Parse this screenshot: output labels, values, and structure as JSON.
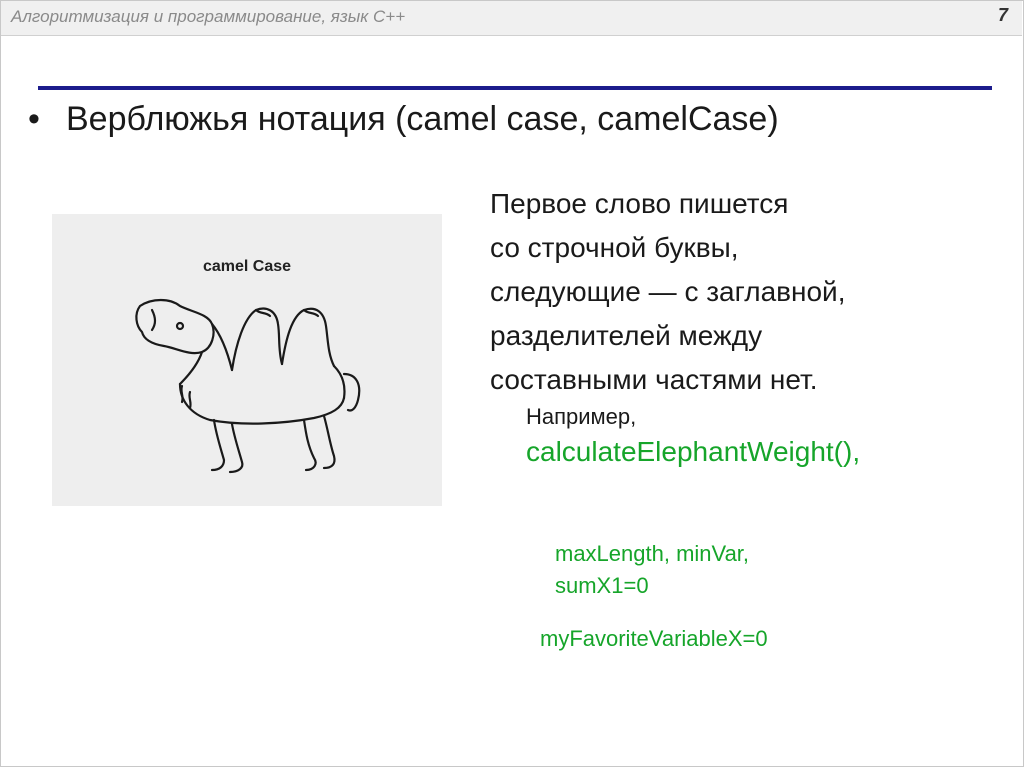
{
  "header": {
    "course_title": "Алгоритмизация и программирование, язык С++",
    "slide_number": "7"
  },
  "slide": {
    "bullet": "•",
    "heading": "Верблюжья нотация (camel case, camelCase)",
    "image_caption": "camel Case",
    "description_lines": [
      "Первое слово пишется",
      "со строчной буквы,",
      "следующие — с заглавной,",
      "разделителей между",
      "составными частями нет."
    ],
    "example_label": "Например,",
    "example_main": "calculateElephantWeight(),",
    "example_2_lines": [
      "maxLength, minVar,",
      "sumX1=0"
    ],
    "example_3": "myFavoriteVariableX=0"
  },
  "colors": {
    "rule": "#1c1c8c",
    "example_text": "#16a52a",
    "header_bg": "#f0f0f0",
    "image_bg": "#eeeeee"
  }
}
